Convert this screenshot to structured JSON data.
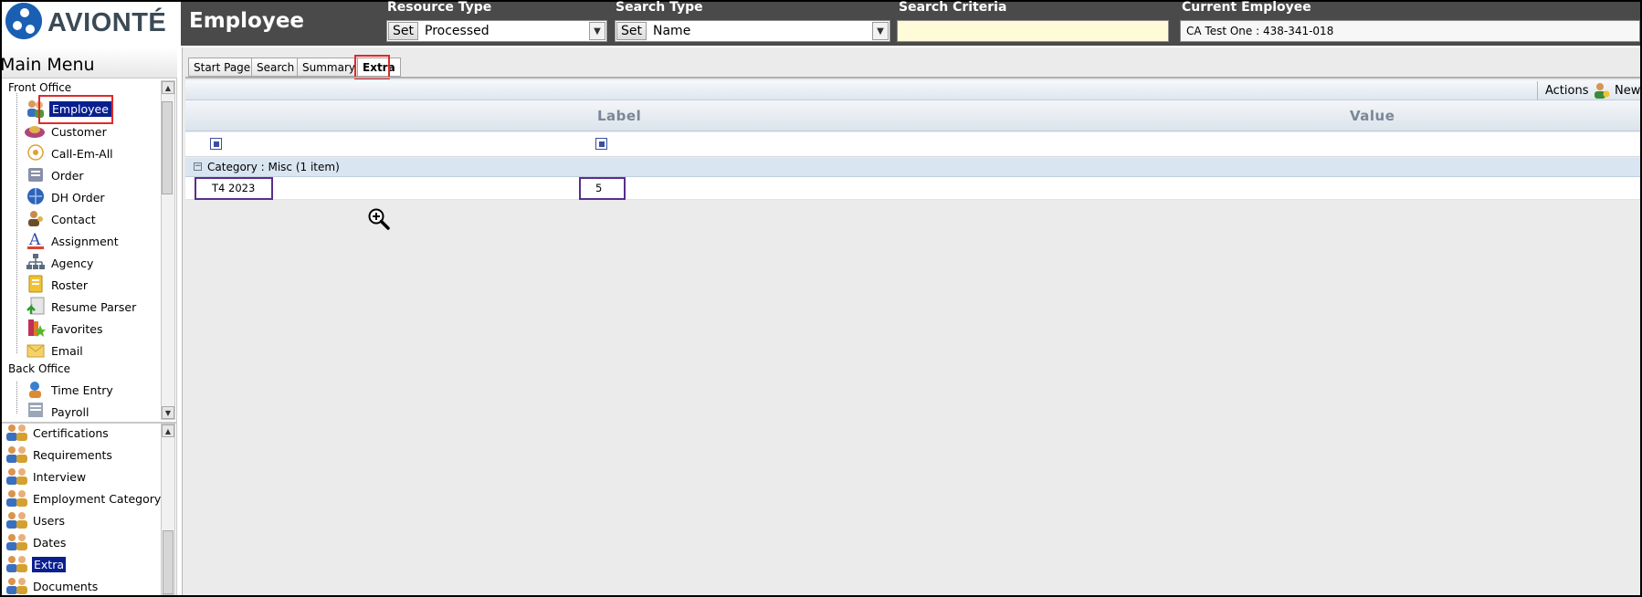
{
  "app": {
    "brand": "AVIONTÉ",
    "page_title": "Employee"
  },
  "header": {
    "resource_type": {
      "label": "Resource Type",
      "set": "Set",
      "value": "Processed"
    },
    "search_type": {
      "label": "Search Type",
      "set": "Set",
      "value": "Name"
    },
    "search_criteria": {
      "label": "Search Criteria",
      "value": ""
    },
    "current_employee": {
      "label": "Current Employee",
      "value": "CA  Test One : 438-341-018"
    }
  },
  "sidebar": {
    "title": "Main Menu",
    "front_office_label": "Front Office",
    "front_office": [
      {
        "label": "Employee",
        "icon": "employee-icon"
      },
      {
        "label": "Customer",
        "icon": "customer-icon"
      },
      {
        "label": "Call-Em-All",
        "icon": "call-em-all-icon"
      },
      {
        "label": "Order",
        "icon": "order-icon"
      },
      {
        "label": "DH Order",
        "icon": "dh-order-icon"
      },
      {
        "label": "Contact",
        "icon": "contact-icon"
      },
      {
        "label": "Assignment",
        "icon": "assignment-icon"
      },
      {
        "label": "Agency",
        "icon": "agency-icon"
      },
      {
        "label": "Roster",
        "icon": "roster-icon"
      },
      {
        "label": "Resume Parser",
        "icon": "resume-parser-icon"
      },
      {
        "label": "Favorites",
        "icon": "favorites-icon"
      },
      {
        "label": "Email",
        "icon": "email-icon"
      }
    ],
    "back_office_label": "Back Office",
    "back_office": [
      {
        "label": "Time Entry",
        "icon": "time-entry-icon"
      },
      {
        "label": "Payroll",
        "icon": "payroll-icon"
      }
    ],
    "sub_items": [
      {
        "label": "Certifications"
      },
      {
        "label": "Requirements"
      },
      {
        "label": "Interview"
      },
      {
        "label": "Employment Category"
      },
      {
        "label": "Users"
      },
      {
        "label": "Dates"
      },
      {
        "label": "Extra"
      },
      {
        "label": "Documents"
      }
    ]
  },
  "tabs": [
    {
      "label": "Start Page"
    },
    {
      "label": "Search"
    },
    {
      "label": "Summary"
    },
    {
      "label": "Extra"
    }
  ],
  "toolbar": {
    "actions": "Actions",
    "new": "New"
  },
  "grid": {
    "columns": [
      "Label",
      "Value"
    ],
    "group": "Category : Misc (1 item)",
    "rows": [
      {
        "label": "T4 2023",
        "value": "5"
      }
    ]
  },
  "colors": {
    "title_bar": "#4a4a4a",
    "brand_blue": "#1b5fb3",
    "selection": "#0a1f8f",
    "highlight_red": "#e02a2a",
    "highlight_purple": "#5a2d8c",
    "search_field": "#fffbd8"
  }
}
